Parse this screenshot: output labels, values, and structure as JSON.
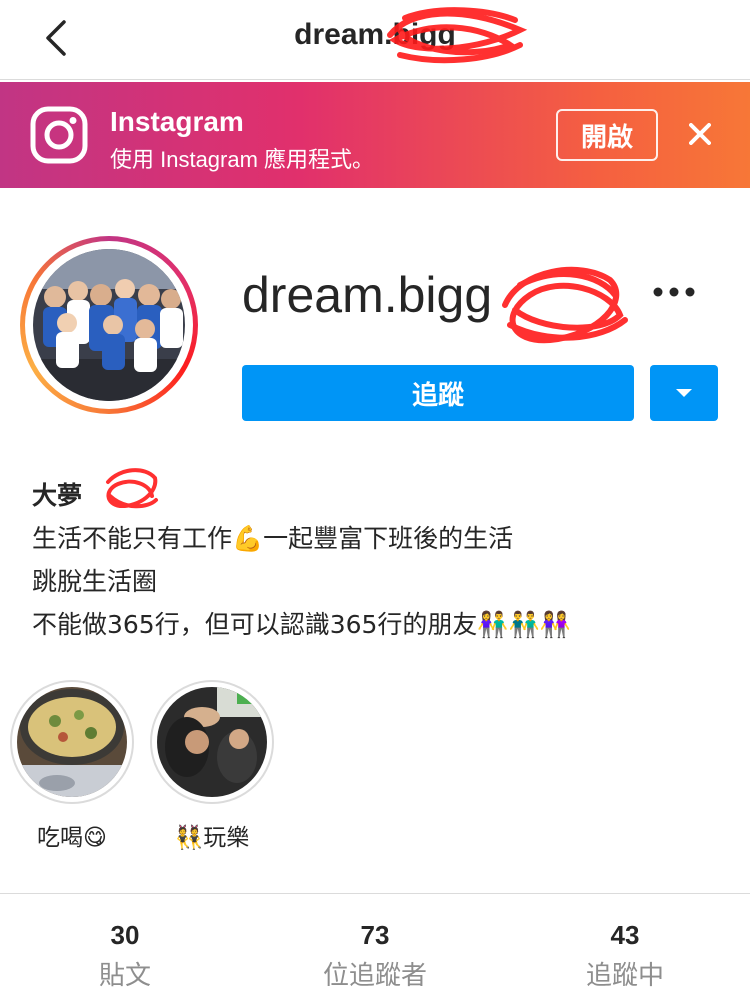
{
  "nav": {
    "title": "dream.bigg",
    "back_icon": "chevron-left-icon"
  },
  "banner": {
    "title": "Instagram",
    "subtitle": "使用 Instagram 應用程式。",
    "open_label": "開啟",
    "close_icon": "close-icon",
    "logo_icon": "instagram-logo-icon"
  },
  "profile": {
    "username": "dream.bigg",
    "follow_label": "追蹤",
    "more_icon": "more-horizontal-icon",
    "dropdown_icon": "caret-down-icon"
  },
  "bio": {
    "name": "大夢",
    "lines": [
      "生活不能只有工作💪一起豐富下班後的生活",
      "跳脫生活圈",
      "不能做365行，但可以認識365行的朋友👫👬👭"
    ]
  },
  "highlights": [
    {
      "label": "吃喝😋"
    },
    {
      "label": "👯玩樂"
    }
  ],
  "stats": {
    "posts_count": "30",
    "posts_label": "貼文",
    "followers_count": "73",
    "followers_label": "位追蹤者",
    "following_count": "43",
    "following_label": "追蹤中"
  },
  "colors": {
    "follow_blue": "#0095f6",
    "banner_gradient_start": "#c13584",
    "banner_gradient_end": "#f77737",
    "redaction_red": "#ff1a1a"
  }
}
